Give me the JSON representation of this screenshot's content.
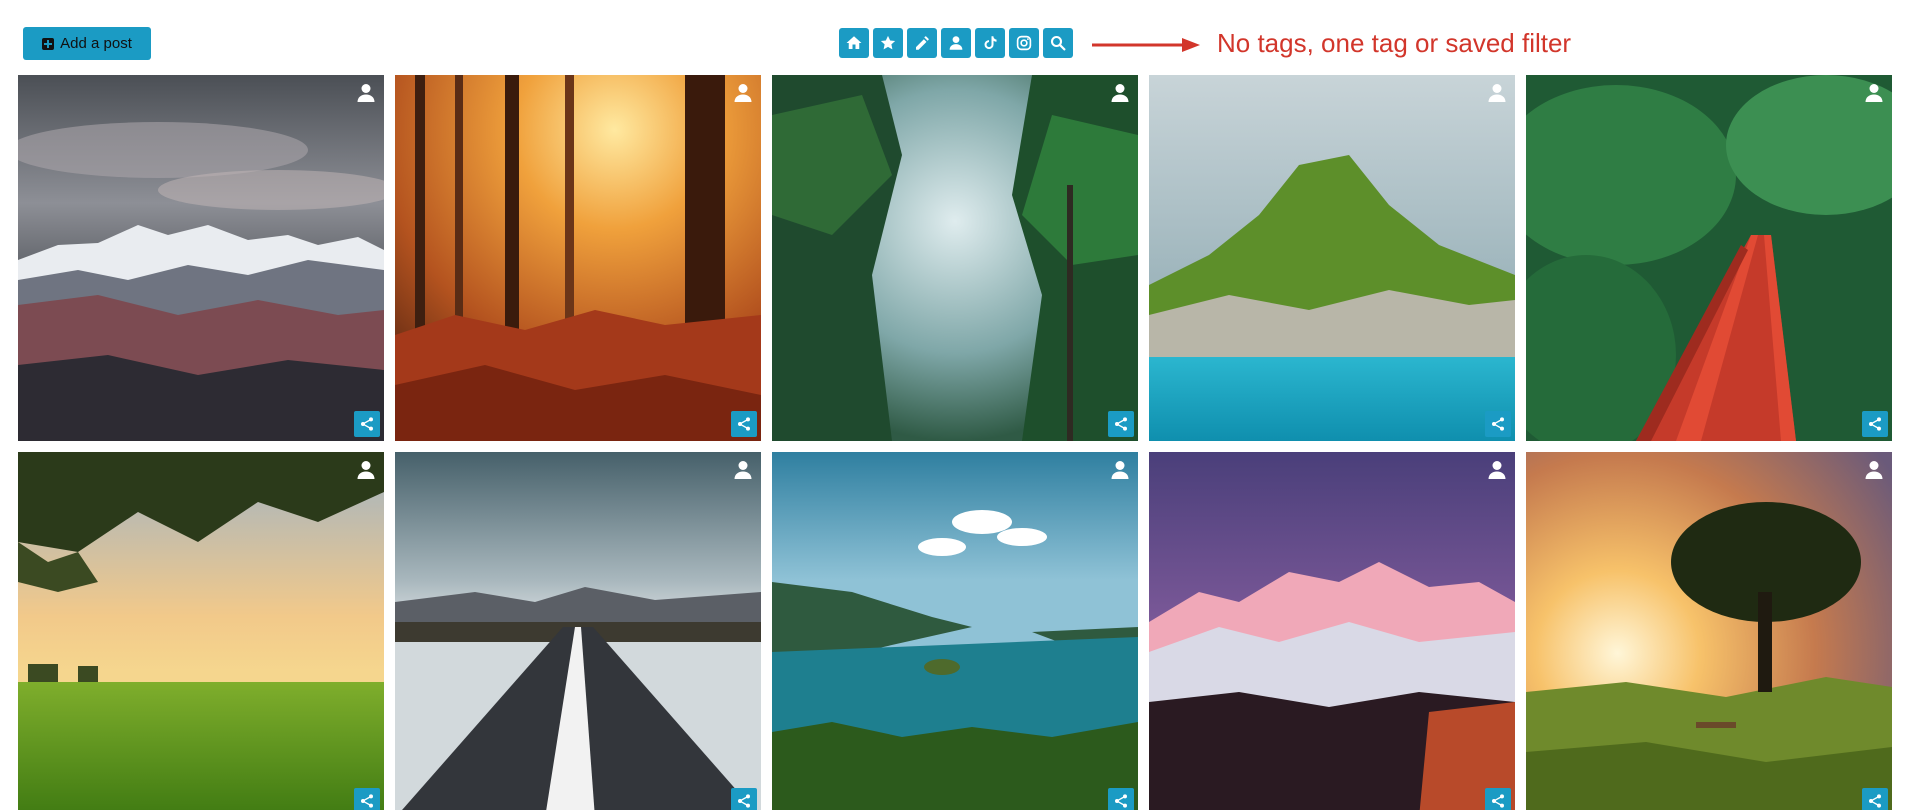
{
  "header": {
    "add_post_label": "Add a post",
    "toolbar": [
      {
        "icon": "home-icon"
      },
      {
        "icon": "star-icon"
      },
      {
        "icon": "pencil-icon"
      },
      {
        "icon": "user-icon"
      },
      {
        "icon": "tiktok-icon"
      },
      {
        "icon": "instagram-icon"
      },
      {
        "icon": "search-icon"
      }
    ]
  },
  "annotation": {
    "text": "No tags, one tag or saved filter",
    "color": "#d2362b"
  },
  "accent_color": "#1b9bc4",
  "posts": [
    {
      "scene": "snowy-mountains",
      "author_icon": "user-icon",
      "share_icon": "share-icon"
    },
    {
      "scene": "autumn-forest",
      "author_icon": "user-icon",
      "share_icon": "share-icon"
    },
    {
      "scene": "misty-forest",
      "author_icon": "user-icon",
      "share_icon": "share-icon"
    },
    {
      "scene": "island-lake",
      "author_icon": "user-icon",
      "share_icon": "share-icon"
    },
    {
      "scene": "red-bridge-jungle",
      "author_icon": "user-icon",
      "share_icon": "share-icon"
    },
    {
      "scene": "green-field-tree",
      "author_icon": "user-icon",
      "share_icon": "share-icon"
    },
    {
      "scene": "road-horizon",
      "author_icon": "user-icon",
      "share_icon": "share-icon"
    },
    {
      "scene": "lake-island-aerial",
      "author_icon": "user-icon",
      "share_icon": "share-icon"
    },
    {
      "scene": "pink-mountains",
      "author_icon": "user-icon",
      "share_icon": "share-icon"
    },
    {
      "scene": "sunset-tree-bench",
      "author_icon": "user-icon",
      "share_icon": "share-icon"
    }
  ]
}
